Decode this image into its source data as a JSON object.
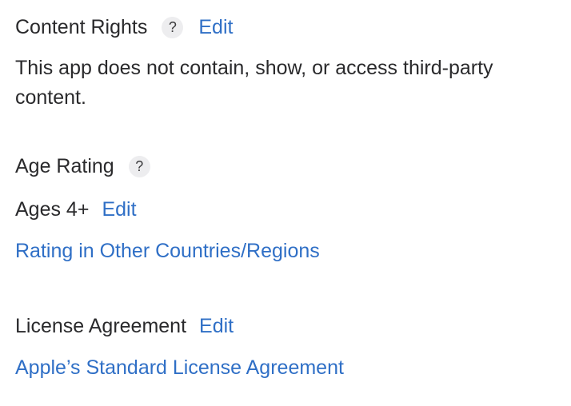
{
  "content_rights": {
    "title": "Content Rights",
    "help": "?",
    "edit": "Edit",
    "description": "This app does not contain, show, or access third-party content."
  },
  "age_rating": {
    "title": "Age Rating",
    "help": "?",
    "value": "Ages 4+",
    "edit": "Edit",
    "other_link": "Rating in Other Countries/Regions"
  },
  "license": {
    "title": "License Agreement",
    "edit": "Edit",
    "link": "Apple’s Standard License Agreement"
  },
  "colors": {
    "link": "#2f6fc6",
    "text": "#2a2a2c",
    "help_bg": "#ededef"
  }
}
